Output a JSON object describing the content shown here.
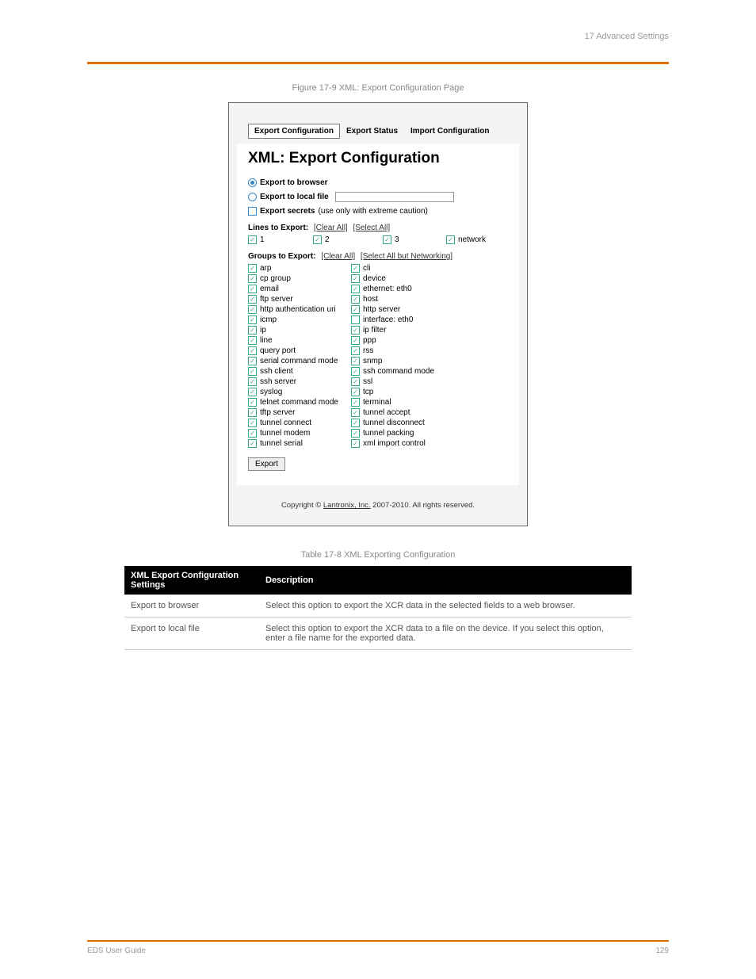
{
  "header": {
    "left": "",
    "right": "17 Advanced Settings"
  },
  "figure_caption": "Figure 17-9  XML: Export Configuration Page",
  "tabs": [
    "Export Configuration",
    "Export Status",
    "Import Configuration"
  ],
  "page_title": "XML: Export Configuration",
  "export_browser": "Export to browser",
  "export_local": "Export to local file",
  "export_secrets_bold": "Export secrets",
  "export_secrets_note": " (use only with extreme caution)",
  "lines_label": "Lines to Export:",
  "clear_all": "[Clear All]",
  "select_all": "[Select All]",
  "lines": [
    "1",
    "2",
    "3",
    "network"
  ],
  "groups_label": "Groups to Export:",
  "select_all_but_net": "[Select All but Networking]",
  "groups": [
    {
      "a": "arp",
      "ac": true,
      "b": "cli",
      "bc": true
    },
    {
      "a": "cp group",
      "ac": true,
      "b": "device",
      "bc": true
    },
    {
      "a": "email",
      "ac": true,
      "b": "ethernet: eth0",
      "bc": true
    },
    {
      "a": "ftp server",
      "ac": true,
      "b": "host",
      "bc": true
    },
    {
      "a": "http authentication uri",
      "ac": true,
      "b": "http server",
      "bc": true
    },
    {
      "a": "icmp",
      "ac": true,
      "b": "interface: eth0",
      "bc": false
    },
    {
      "a": "ip",
      "ac": true,
      "b": "ip filter",
      "bc": true
    },
    {
      "a": "line",
      "ac": true,
      "b": "ppp",
      "bc": true
    },
    {
      "a": "query port",
      "ac": true,
      "b": "rss",
      "bc": true
    },
    {
      "a": "serial command mode",
      "ac": true,
      "b": "snmp",
      "bc": true
    },
    {
      "a": "ssh client",
      "ac": true,
      "b": "ssh command mode",
      "bc": true
    },
    {
      "a": "ssh server",
      "ac": true,
      "b": "ssl",
      "bc": true
    },
    {
      "a": "syslog",
      "ac": true,
      "b": "tcp",
      "bc": true
    },
    {
      "a": "telnet command mode",
      "ac": true,
      "b": "terminal",
      "bc": true
    },
    {
      "a": "tftp server",
      "ac": true,
      "b": "tunnel accept",
      "bc": true
    },
    {
      "a": "tunnel connect",
      "ac": true,
      "b": "tunnel disconnect",
      "bc": true
    },
    {
      "a": "tunnel modem",
      "ac": true,
      "b": "tunnel packing",
      "bc": true
    },
    {
      "a": "tunnel serial",
      "ac": true,
      "b": "xml import control",
      "bc": true
    }
  ],
  "export_btn": "Export",
  "copyright_pre": "Copyright © ",
  "copyright_link": "Lantronix, Inc.",
  "copyright_post": " 2007-2010. All rights reserved.",
  "table_caption": "Table 17-8  XML Exporting Configuration",
  "table_head": [
    "XML Export Configuration Settings",
    "Description"
  ],
  "table_rows": [
    [
      "Export to browser",
      "Select this option to export the XCR data in the selected fields to a web browser."
    ],
    [
      "Export to local file",
      "Select this option to export the XCR data to a file on the device. If you select this option, enter a file name for the exported data."
    ]
  ],
  "footer": {
    "left": "EDS User Guide",
    "right": "129"
  }
}
